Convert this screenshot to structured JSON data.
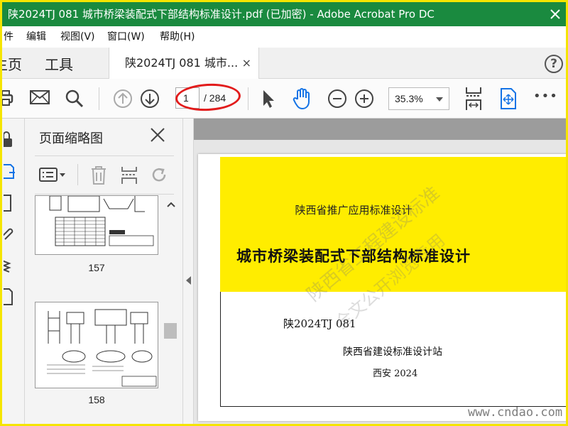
{
  "window": {
    "title": "陕2024TJ 081 城市桥梁装配式下部结构标准设计.pdf  (已加密)  - Adobe Acrobat Pro DC"
  },
  "menu": {
    "items": [
      "件",
      "编辑",
      "视图(V)",
      "窗口(W)",
      "帮助(H)"
    ]
  },
  "tabs": {
    "home": "主页",
    "tools": "工具",
    "document": "陕2024TJ 081 城市...",
    "document_close": "×"
  },
  "help_label": "?",
  "toolbar": {
    "page_current": "1",
    "page_total": "/ 284",
    "zoom": "35.3%",
    "more": "•••"
  },
  "thumbnails": {
    "title": "页面缩略图",
    "pages": [
      "157",
      "158"
    ]
  },
  "document": {
    "subtitle": "陕西省推广应用标准设计",
    "title": "城市桥梁装配式下部结构标准设计",
    "code": "陕2024TJ  081",
    "organization": "陕西省建设标准设计站",
    "place_year": "西安  2024",
    "watermark_line1": "陕西省工程建设标准",
    "watermark_line2": "全文公开浏览专用"
  },
  "site_watermark": "www.cndao.com",
  "colors": {
    "titlebar": "#1a8a3f",
    "frame_highlight": "#f5e500",
    "cover_yellow": "#ffed00",
    "annotation_red": "#e21b1b",
    "active_icon_blue": "#1473e6"
  },
  "icons": {
    "print": "print-icon",
    "mail": "mail-icon",
    "search": "search-icon",
    "prev_page": "arrow-up-circle-icon",
    "next_page": "arrow-down-circle-icon",
    "select": "pointer-icon",
    "hand": "hand-icon",
    "zoom_out": "zoom-out-icon",
    "zoom_in": "zoom-in-icon",
    "fit_page": "fit-page-icon",
    "scroll_mode": "scroll-mode-icon"
  }
}
